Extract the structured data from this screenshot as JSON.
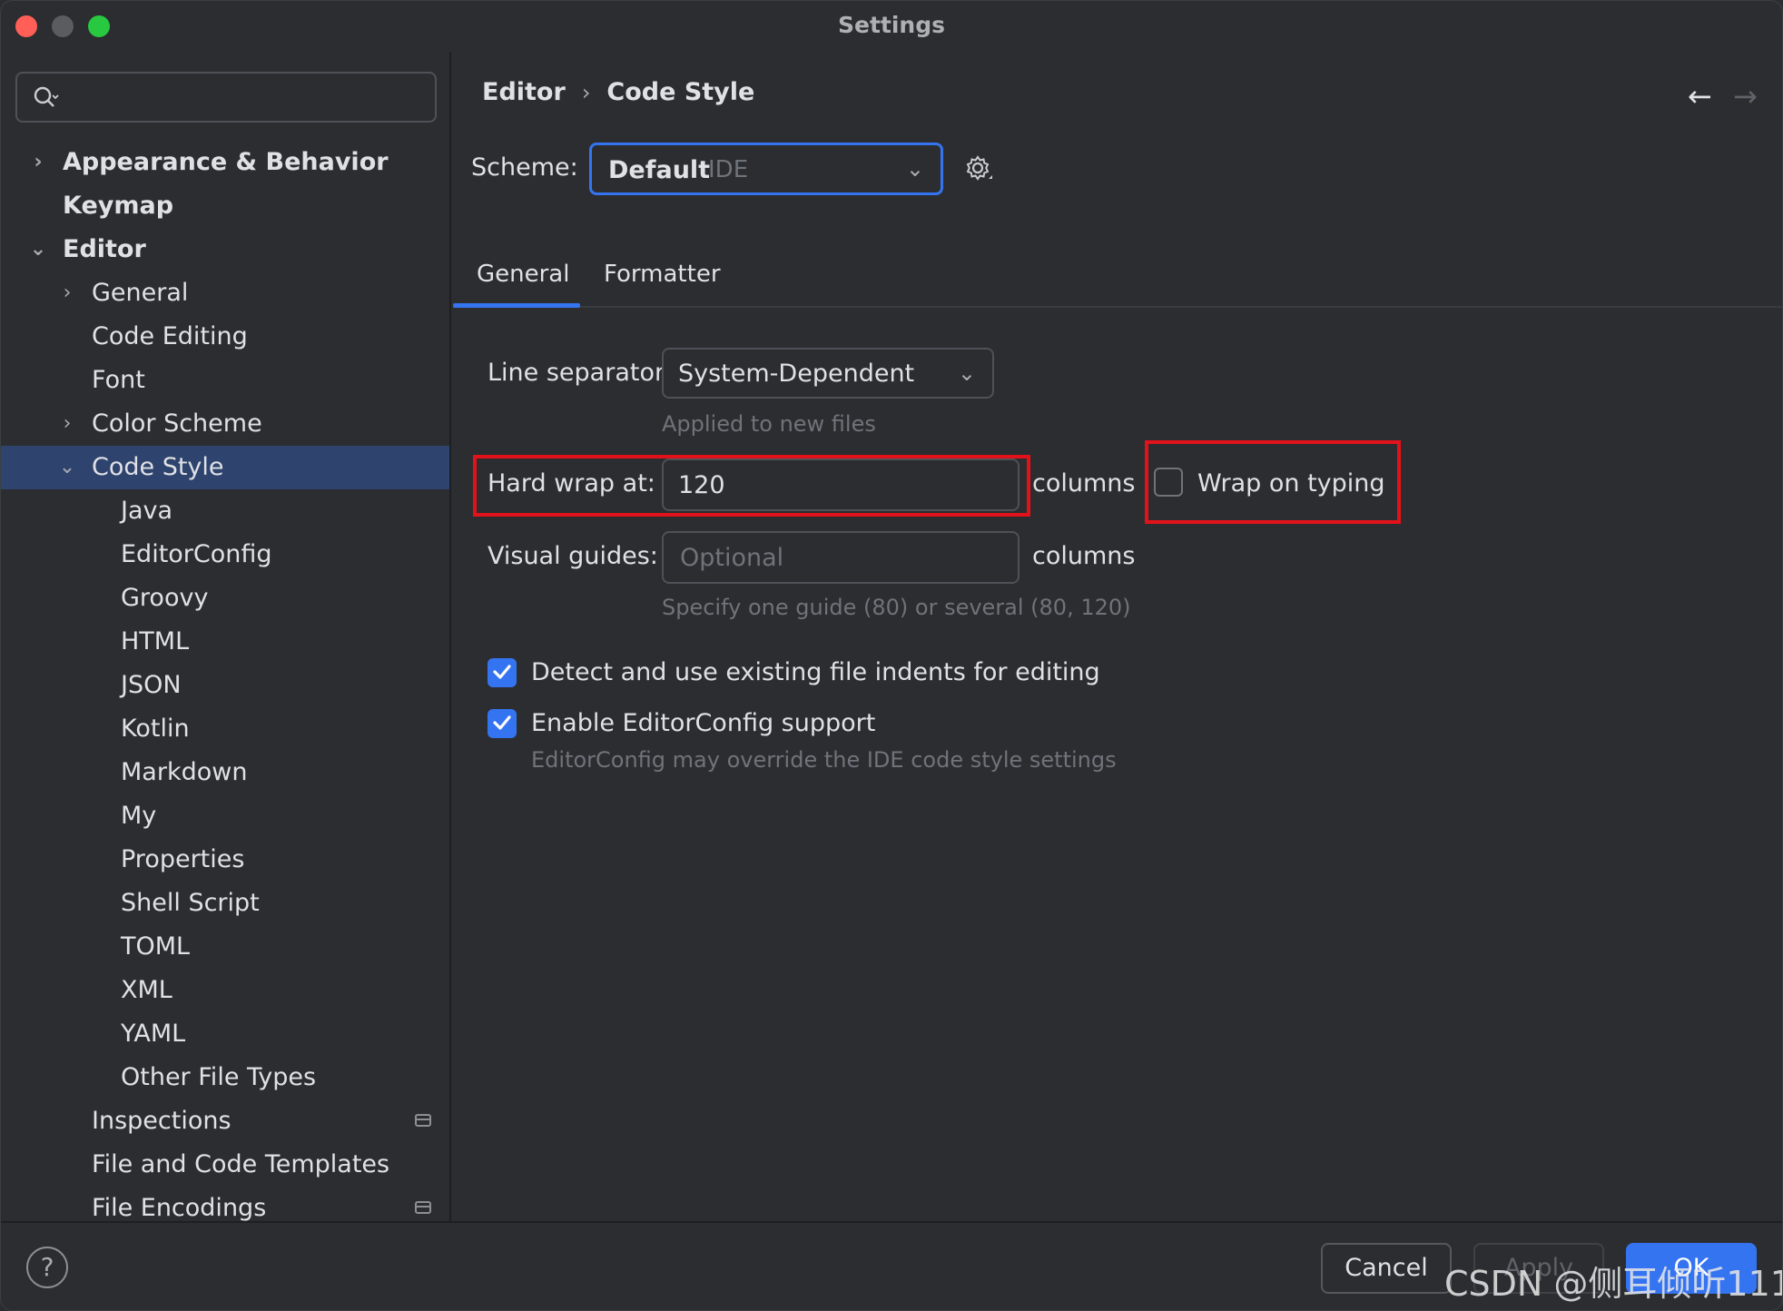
{
  "window": {
    "title": "Settings"
  },
  "sidebar": {
    "search": {
      "placeholder": ""
    },
    "items": [
      {
        "label": "Appearance & Behavior",
        "level": 0,
        "bold": true,
        "chevron": "right"
      },
      {
        "label": "Keymap",
        "level": 0,
        "bold": true,
        "chevron": ""
      },
      {
        "label": "Editor",
        "level": 0,
        "bold": true,
        "chevron": "down"
      },
      {
        "label": "General",
        "level": 1,
        "chevron": "right"
      },
      {
        "label": "Code Editing",
        "level": 1,
        "chevron": ""
      },
      {
        "label": "Font",
        "level": 1,
        "chevron": ""
      },
      {
        "label": "Color Scheme",
        "level": 1,
        "chevron": "right"
      },
      {
        "label": "Code Style",
        "level": 1,
        "chevron": "down",
        "selected": true
      },
      {
        "label": "Java",
        "level": 2
      },
      {
        "label": "EditorConfig",
        "level": 2
      },
      {
        "label": "Groovy",
        "level": 2
      },
      {
        "label": "HTML",
        "level": 2
      },
      {
        "label": "JSON",
        "level": 2
      },
      {
        "label": "Kotlin",
        "level": 2
      },
      {
        "label": "Markdown",
        "level": 2
      },
      {
        "label": "My",
        "level": 2
      },
      {
        "label": "Properties",
        "level": 2
      },
      {
        "label": "Shell Script",
        "level": 2
      },
      {
        "label": "TOML",
        "level": 2
      },
      {
        "label": "XML",
        "level": 2
      },
      {
        "label": "YAML",
        "level": 2
      },
      {
        "label": "Other File Types",
        "level": 2
      },
      {
        "label": "Inspections",
        "level": 1,
        "badge": true
      },
      {
        "label": "File and Code Templates",
        "level": 1
      },
      {
        "label": "File Encodings",
        "level": 1,
        "badge": true
      }
    ]
  },
  "main": {
    "breadcrumb": {
      "parent": "Editor",
      "separator": "›",
      "current": "Code Style"
    },
    "nav": {
      "back": "←",
      "forward": "→"
    },
    "scheme": {
      "label": "Scheme:",
      "value": "Default",
      "sub": "IDE"
    },
    "tabs": [
      {
        "label": "General",
        "active": true
      },
      {
        "label": "Formatter",
        "active": false
      }
    ],
    "general": {
      "line_separator_label": "Line separator:",
      "line_separator_value": "System-Dependent",
      "line_separator_hint": "Applied to new files",
      "hard_wrap_label": "Hard wrap at:",
      "hard_wrap_value": "120",
      "columns_label": "columns",
      "wrap_on_typing_label": "Wrap on typing",
      "wrap_on_typing_checked": false,
      "visual_guides_label": "Visual guides:",
      "visual_guides_placeholder": "Optional",
      "visual_guides_hint": "Specify one guide (80) or several (80, 120)",
      "detect_indents_label": "Detect and use existing file indents for editing",
      "detect_indents_checked": true,
      "editorconfig_label": "Enable EditorConfig support",
      "editorconfig_checked": true,
      "editorconfig_hint": "EditorConfig may override the IDE code style settings"
    }
  },
  "footer": {
    "help": "?",
    "cancel": "Cancel",
    "apply": "Apply",
    "ok": "OK",
    "watermark": "CSDN @侧耳倾听111"
  },
  "colors": {
    "accent": "#3574f0",
    "background": "#2b2d30",
    "selection": "#2e436e",
    "highlight_box": "#e3121a"
  }
}
